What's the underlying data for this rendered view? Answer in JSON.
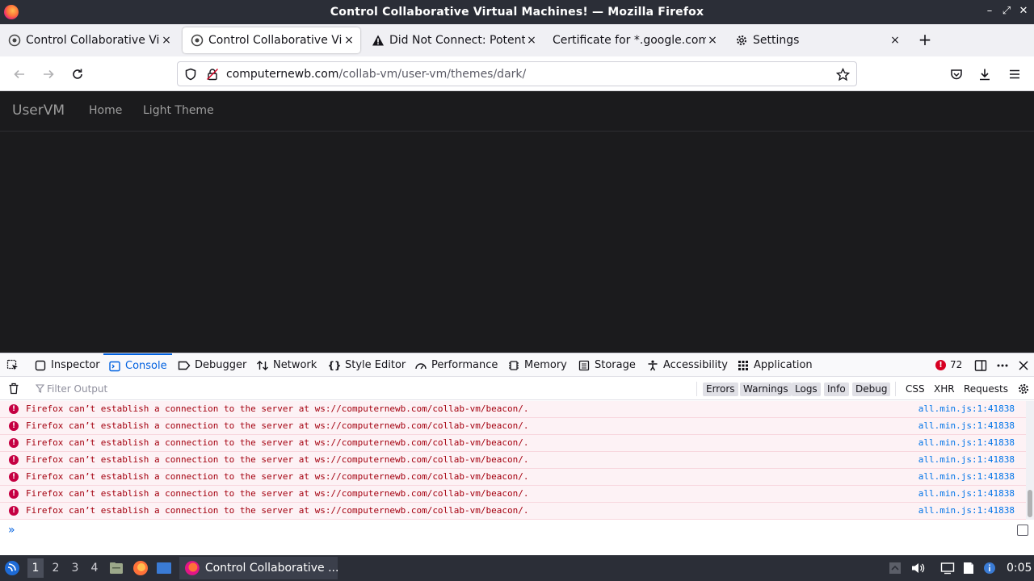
{
  "window": {
    "title": "Control Collaborative Virtual Machines! — Mozilla Firefox",
    "minimize_glyph": "–",
    "maximize_glyph": "⤢",
    "close_glyph": "✕"
  },
  "tabs": [
    {
      "label": "Control Collaborative Virtual Machines!",
      "icon": "collab-vm-favicon",
      "active": false
    },
    {
      "label": "Control Collaborative Virtual Machines!",
      "icon": "collab-vm-favicon",
      "active": true
    },
    {
      "label": "Did Not Connect: Potential Security Issue",
      "icon": "warning-icon",
      "active": false
    },
    {
      "label": "Certificate for *.google.com",
      "icon": "",
      "active": false
    },
    {
      "label": "Settings",
      "icon": "gear-icon",
      "active": false
    }
  ],
  "tab_close_glyph": "×",
  "new_tab_glyph": "+",
  "urlbar": {
    "host": "computernewb.com",
    "path": "/collab-vm/user-vm/themes/dark/"
  },
  "site": {
    "brand": "UserVM",
    "links": [
      "Home",
      "Light Theme"
    ]
  },
  "devtools": {
    "tabs": [
      "Inspector",
      "Console",
      "Debugger",
      "Network",
      "Style Editor",
      "Performance",
      "Memory",
      "Storage",
      "Accessibility",
      "Application"
    ],
    "active_tab": "Console",
    "error_count": "72",
    "filter_placeholder": "Filter Output",
    "filter_levels": [
      "Errors",
      "Warnings",
      "Logs",
      "Info",
      "Debug"
    ],
    "filter_extra": [
      "CSS",
      "XHR",
      "Requests"
    ],
    "log_entries": [
      {
        "message": "Firefox can’t establish a connection to the server at ws://computernewb.com/collab-vm/beacon/.",
        "source": "all.min.js:1:41838"
      },
      {
        "message": "Firefox can’t establish a connection to the server at ws://computernewb.com/collab-vm/beacon/.",
        "source": "all.min.js:1:41838"
      },
      {
        "message": "Firefox can’t establish a connection to the server at ws://computernewb.com/collab-vm/beacon/.",
        "source": "all.min.js:1:41838"
      },
      {
        "message": "Firefox can’t establish a connection to the server at ws://computernewb.com/collab-vm/beacon/.",
        "source": "all.min.js:1:41838"
      },
      {
        "message": "Firefox can’t establish a connection to the server at ws://computernewb.com/collab-vm/beacon/.",
        "source": "all.min.js:1:41838"
      },
      {
        "message": "Firefox can’t establish a connection to the server at ws://computernewb.com/collab-vm/beacon/.",
        "source": "all.min.js:1:41838"
      },
      {
        "message": "Firefox can’t establish a connection to the server at ws://computernewb.com/collab-vm/beacon/.",
        "source": "all.min.js:1:41838"
      }
    ],
    "prompt_glyph": "»"
  },
  "taskbar": {
    "workspaces": [
      "1",
      "2",
      "3",
      "4"
    ],
    "active_workspace": "1",
    "task_label": "Control Collaborative ...",
    "clock": "0:05"
  },
  "colors": {
    "accent": "#0061e0",
    "error": "#a4000f",
    "page_bg": "#1b1b1d",
    "titlebar_bg": "#2b2e37"
  }
}
